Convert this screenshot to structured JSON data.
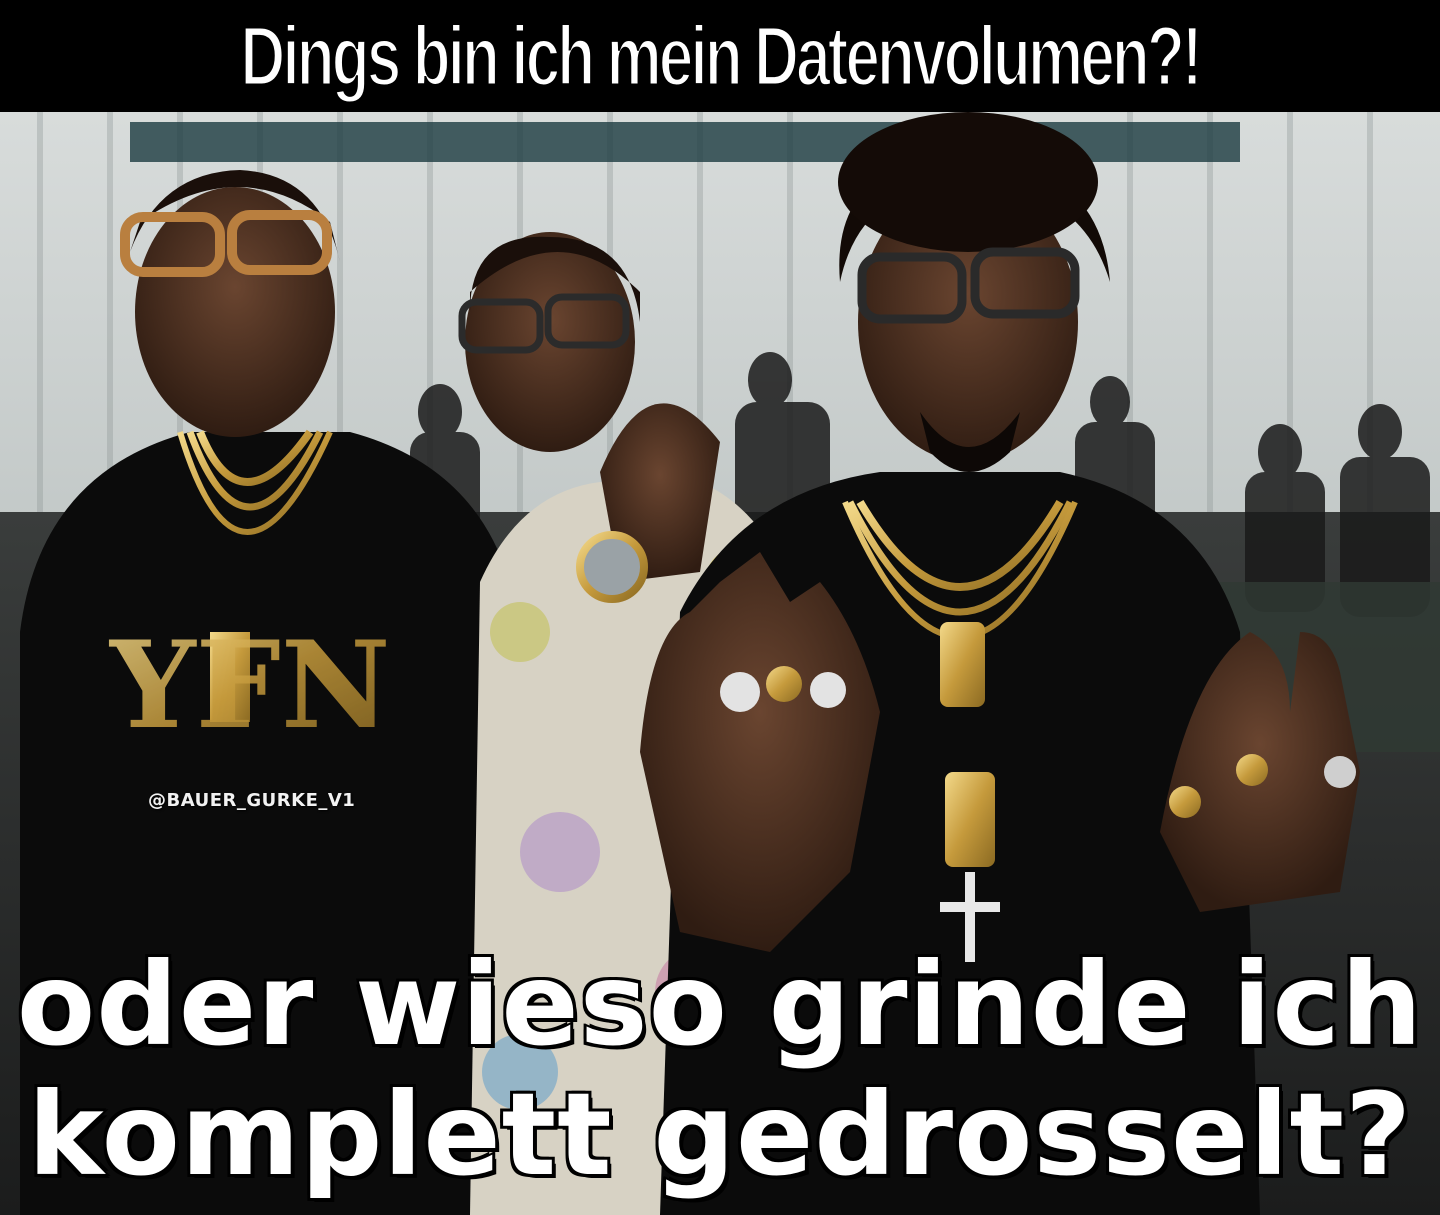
{
  "meme": {
    "top_caption": "Dings bin ich mein Datenvolumen?!",
    "bottom_caption_line_1": "oder wieso grinde ich",
    "bottom_caption_line_2": "komplett gedrosselt?",
    "watermark": "@BAUER_GURKE_V1",
    "shirt_print": "YFN"
  }
}
